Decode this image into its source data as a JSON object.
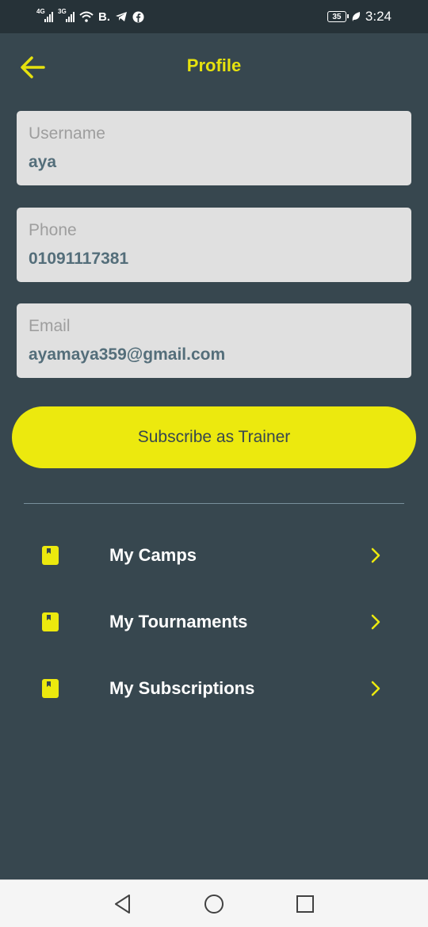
{
  "status_bar": {
    "network_1": "4G",
    "network_2": "3G",
    "carrier_label": "B.",
    "battery_level": "35",
    "time": "3:24"
  },
  "app_bar": {
    "title": "Profile",
    "back_icon": "arrow-left-icon"
  },
  "fields": {
    "username": {
      "label": "Username",
      "value": "aya"
    },
    "phone": {
      "label": "Phone",
      "value": "01091117381"
    },
    "email": {
      "label": "Email",
      "value": "ayamaya359@gmail.com"
    }
  },
  "subscribe_button": {
    "label": "Subscribe as Trainer"
  },
  "menu": {
    "items": [
      {
        "label": "My Camps",
        "icon": "book-icon"
      },
      {
        "label": "My Tournaments",
        "icon": "book-icon"
      },
      {
        "label": "My Subscriptions",
        "icon": "book-icon"
      }
    ]
  },
  "colors": {
    "background": "#37474f",
    "accent": "#ece90e",
    "field_background": "#e0e0e0",
    "status_bar": "#263238"
  },
  "nav_bar": {
    "back": "triangle-back-icon",
    "home": "circle-home-icon",
    "recents": "square-recents-icon"
  }
}
